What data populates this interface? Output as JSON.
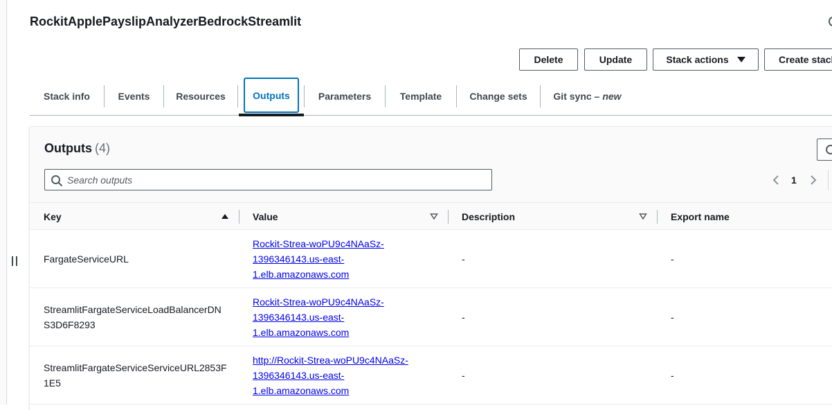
{
  "stack": {
    "title": "RockitApplePayslipAnalyzerBedrockStreamlit"
  },
  "actions": {
    "delete": "Delete",
    "update": "Update",
    "stack_actions": "Stack actions",
    "create_stack": "Create stack"
  },
  "tabs": [
    {
      "label": "Stack info"
    },
    {
      "label": "Events"
    },
    {
      "label": "Resources"
    },
    {
      "label": "Outputs"
    },
    {
      "label": "Parameters"
    },
    {
      "label": "Template"
    },
    {
      "label": "Change sets"
    },
    {
      "label": "Git sync –",
      "tag": "new"
    }
  ],
  "active_tab": "Outputs",
  "outputs": {
    "title": "Outputs",
    "count": "(4)",
    "search_placeholder": "Search outputs",
    "page": "1",
    "columns": {
      "key": "Key",
      "value": "Value",
      "description": "Description",
      "export_name": "Export name"
    },
    "rows": [
      {
        "key": "FargateServiceURL",
        "value": "Rockit-Strea-woPU9c4NAaSz-1396346143.us-east-1.elb.amazonaws.com",
        "description": "-",
        "export_name": "-"
      },
      {
        "key": "StreamlitFargateServiceLoadBalancerDNS3D6F8293",
        "value": "Rockit-Strea-woPU9c4NAaSz-1396346143.us-east-1.elb.amazonaws.com",
        "description": "-",
        "export_name": "-"
      },
      {
        "key": "StreamlitFargateServiceServiceURL2853F1E5",
        "value": "http://Rockit-Strea-woPU9c4NAaSz-1396346143.us-east-1.elb.amazonaws.com",
        "description": "-",
        "export_name": "-"
      }
    ]
  },
  "icons": {
    "search": "search-icon",
    "sort_asc": "caret-up-icon",
    "sort_unsorted": "caret-down-outline-icon",
    "prev": "chevron-left-icon",
    "next": "chevron-right-icon",
    "refresh": "refresh-icon",
    "dropdown": "caret-down-icon"
  },
  "colors": {
    "accent": "#0073bb",
    "link": "#0000ee",
    "text": "#16191f"
  }
}
